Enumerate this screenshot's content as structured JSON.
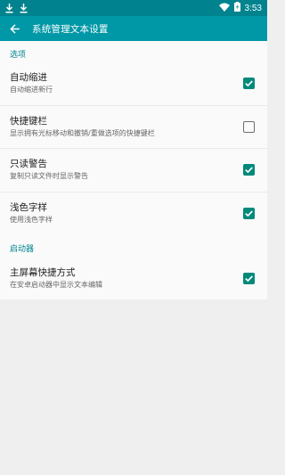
{
  "status_bar": {
    "time": "3:53",
    "icons": [
      "download-icon",
      "download-icon",
      "wifi-icon",
      "battery-charging-icon"
    ]
  },
  "app_bar": {
    "title": "系统管理文本设置",
    "back_icon": "arrow-back-icon"
  },
  "sections": [
    {
      "header": "选项",
      "items": [
        {
          "title": "自动缩进",
          "summary": "自动缩进新行",
          "checked": true
        },
        {
          "title": "快捷键栏",
          "summary": "显示拥有光标移动和撤销/重做选项的快捷键栏",
          "checked": false
        },
        {
          "title": "只读警告",
          "summary": "复制只读文件时显示警告",
          "checked": true
        },
        {
          "title": "浅色字样",
          "summary": "使用浅色字样",
          "checked": true
        }
      ]
    },
    {
      "header": "启动器",
      "items": [
        {
          "title": "主屏幕快捷方式",
          "summary": "在安卓启动器中显示文本编辑",
          "checked": true
        }
      ]
    }
  ],
  "colors": {
    "status_bar": "#00838f",
    "app_bar": "#0097a7",
    "accent": "#00897b",
    "background": "#efefef"
  }
}
